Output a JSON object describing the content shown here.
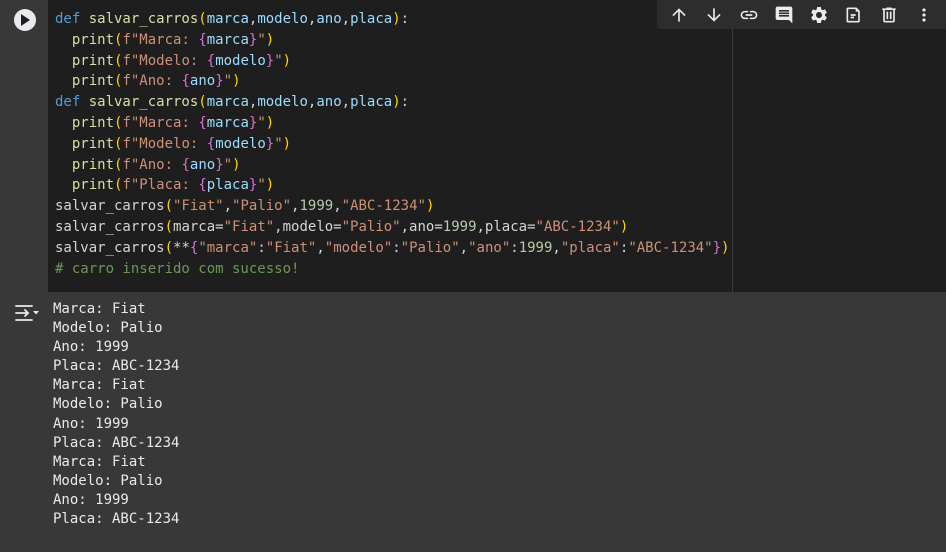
{
  "cell": {
    "run_button_icon": "play-icon",
    "code_lines": [
      [
        {
          "t": "def ",
          "c": "kw"
        },
        {
          "t": "salvar_carros",
          "c": "fn"
        },
        {
          "t": "(",
          "c": "br1"
        },
        {
          "t": "marca",
          "c": "pm"
        },
        {
          "t": ",",
          "c": ""
        },
        {
          "t": "modelo",
          "c": "pm"
        },
        {
          "t": ",",
          "c": ""
        },
        {
          "t": "ano",
          "c": "pm"
        },
        {
          "t": ",",
          "c": ""
        },
        {
          "t": "placa",
          "c": "pm"
        },
        {
          "t": ")",
          "c": "br1"
        },
        {
          "t": ":",
          "c": ""
        }
      ],
      [
        {
          "t": "  print",
          "c": "fn"
        },
        {
          "t": "(",
          "c": "br1"
        },
        {
          "t": "f\"Marca: ",
          "c": "st"
        },
        {
          "t": "{",
          "c": "br2"
        },
        {
          "t": "marca",
          "c": "pm"
        },
        {
          "t": "}",
          "c": "br2"
        },
        {
          "t": "\"",
          "c": "st"
        },
        {
          "t": ")",
          "c": "br1"
        }
      ],
      [
        {
          "t": "  print",
          "c": "fn"
        },
        {
          "t": "(",
          "c": "br1"
        },
        {
          "t": "f\"Modelo: ",
          "c": "st"
        },
        {
          "t": "{",
          "c": "br2"
        },
        {
          "t": "modelo",
          "c": "pm"
        },
        {
          "t": "}",
          "c": "br2"
        },
        {
          "t": "\"",
          "c": "st"
        },
        {
          "t": ")",
          "c": "br1"
        }
      ],
      [
        {
          "t": "  print",
          "c": "fn"
        },
        {
          "t": "(",
          "c": "br1"
        },
        {
          "t": "f\"Ano: ",
          "c": "st"
        },
        {
          "t": "{",
          "c": "br2"
        },
        {
          "t": "ano",
          "c": "pm"
        },
        {
          "t": "}",
          "c": "br2"
        },
        {
          "t": "\"",
          "c": "st"
        },
        {
          "t": ")",
          "c": "br1"
        }
      ],
      [
        {
          "t": "def ",
          "c": "kw"
        },
        {
          "t": "salvar_carros",
          "c": "fn"
        },
        {
          "t": "(",
          "c": "br1"
        },
        {
          "t": "marca",
          "c": "pm"
        },
        {
          "t": ",",
          "c": ""
        },
        {
          "t": "modelo",
          "c": "pm"
        },
        {
          "t": ",",
          "c": ""
        },
        {
          "t": "ano",
          "c": "pm"
        },
        {
          "t": ",",
          "c": ""
        },
        {
          "t": "placa",
          "c": "pm"
        },
        {
          "t": ")",
          "c": "br1"
        },
        {
          "t": ":",
          "c": ""
        }
      ],
      [
        {
          "t": "  print",
          "c": "fn"
        },
        {
          "t": "(",
          "c": "br1"
        },
        {
          "t": "f\"Marca: ",
          "c": "st"
        },
        {
          "t": "{",
          "c": "br2"
        },
        {
          "t": "marca",
          "c": "pm"
        },
        {
          "t": "}",
          "c": "br2"
        },
        {
          "t": "\"",
          "c": "st"
        },
        {
          "t": ")",
          "c": "br1"
        }
      ],
      [
        {
          "t": "  print",
          "c": "fn"
        },
        {
          "t": "(",
          "c": "br1"
        },
        {
          "t": "f\"Modelo: ",
          "c": "st"
        },
        {
          "t": "{",
          "c": "br2"
        },
        {
          "t": "modelo",
          "c": "pm"
        },
        {
          "t": "}",
          "c": "br2"
        },
        {
          "t": "\"",
          "c": "st"
        },
        {
          "t": ")",
          "c": "br1"
        }
      ],
      [
        {
          "t": "  print",
          "c": "fn"
        },
        {
          "t": "(",
          "c": "br1"
        },
        {
          "t": "f\"Ano: ",
          "c": "st"
        },
        {
          "t": "{",
          "c": "br2"
        },
        {
          "t": "ano",
          "c": "pm"
        },
        {
          "t": "}",
          "c": "br2"
        },
        {
          "t": "\"",
          "c": "st"
        },
        {
          "t": ")",
          "c": "br1"
        }
      ],
      [
        {
          "t": "  print",
          "c": "fn"
        },
        {
          "t": "(",
          "c": "br1"
        },
        {
          "t": "f\"Placa: ",
          "c": "st"
        },
        {
          "t": "{",
          "c": "br2"
        },
        {
          "t": "placa",
          "c": "pm"
        },
        {
          "t": "}",
          "c": "br2"
        },
        {
          "t": "\"",
          "c": "st"
        },
        {
          "t": ")",
          "c": "br1"
        }
      ],
      [
        {
          "t": "salvar_carros",
          "c": ""
        },
        {
          "t": "(",
          "c": "br1"
        },
        {
          "t": "\"Fiat\"",
          "c": "st"
        },
        {
          "t": ",",
          "c": ""
        },
        {
          "t": "\"Palio\"",
          "c": "st"
        },
        {
          "t": ",",
          "c": ""
        },
        {
          "t": "1999",
          "c": "nm"
        },
        {
          "t": ",",
          "c": ""
        },
        {
          "t": "\"ABC-1234\"",
          "c": "st"
        },
        {
          "t": ")",
          "c": "br1"
        }
      ],
      [
        {
          "t": "salvar_carros",
          "c": ""
        },
        {
          "t": "(",
          "c": "br1"
        },
        {
          "t": "marca=",
          "c": ""
        },
        {
          "t": "\"Fiat\"",
          "c": "st"
        },
        {
          "t": ",modelo=",
          "c": ""
        },
        {
          "t": "\"Palio\"",
          "c": "st"
        },
        {
          "t": ",ano=",
          "c": ""
        },
        {
          "t": "1999",
          "c": "nm"
        },
        {
          "t": ",placa=",
          "c": ""
        },
        {
          "t": "\"ABC-1234\"",
          "c": "st"
        },
        {
          "t": ")",
          "c": "br1"
        }
      ],
      [
        {
          "t": "salvar_carros",
          "c": ""
        },
        {
          "t": "(",
          "c": "br1"
        },
        {
          "t": "**",
          "c": ""
        },
        {
          "t": "{",
          "c": "br2"
        },
        {
          "t": "\"marca\"",
          "c": "st"
        },
        {
          "t": ":",
          "c": ""
        },
        {
          "t": "\"Fiat\"",
          "c": "st"
        },
        {
          "t": ",",
          "c": ""
        },
        {
          "t": "\"modelo\"",
          "c": "st"
        },
        {
          "t": ":",
          "c": ""
        },
        {
          "t": "\"Palio\"",
          "c": "st"
        },
        {
          "t": ",",
          "c": ""
        },
        {
          "t": "\"ano\"",
          "c": "st"
        },
        {
          "t": ":",
          "c": ""
        },
        {
          "t": "1999",
          "c": "nm"
        },
        {
          "t": ",",
          "c": ""
        },
        {
          "t": "\"placa\"",
          "c": "st"
        },
        {
          "t": ":",
          "c": ""
        },
        {
          "t": "\"ABC-1234\"",
          "c": "st"
        },
        {
          "t": "}",
          "c": "br2"
        },
        {
          "t": ")",
          "c": "br1"
        }
      ],
      [
        {
          "t": "# carro inserido com sucesso!",
          "c": "cm"
        }
      ]
    ]
  },
  "toolbar": {
    "buttons": [
      {
        "name": "move-cell-up-button",
        "icon": "arrow-up-icon"
      },
      {
        "name": "move-cell-down-button",
        "icon": "arrow-down-icon"
      },
      {
        "name": "copy-link-button",
        "icon": "link-icon"
      },
      {
        "name": "add-comment-button",
        "icon": "comment-icon"
      },
      {
        "name": "cell-settings-button",
        "icon": "gear-icon"
      },
      {
        "name": "mirror-cell-button",
        "icon": "mirror-tab-icon"
      },
      {
        "name": "delete-cell-button",
        "icon": "trash-icon"
      },
      {
        "name": "more-actions-button",
        "icon": "more-vert-icon"
      }
    ]
  },
  "output": {
    "icon": "output-toggle-icon",
    "lines": [
      "Marca: Fiat",
      "Modelo: Palio",
      "Ano: 1999",
      "Placa: ABC-1234",
      "Marca: Fiat",
      "Modelo: Palio",
      "Ano: 1999",
      "Placa: ABC-1234",
      "Marca: Fiat",
      "Modelo: Palio",
      "Ano: 1999",
      "Placa: ABC-1234"
    ]
  }
}
